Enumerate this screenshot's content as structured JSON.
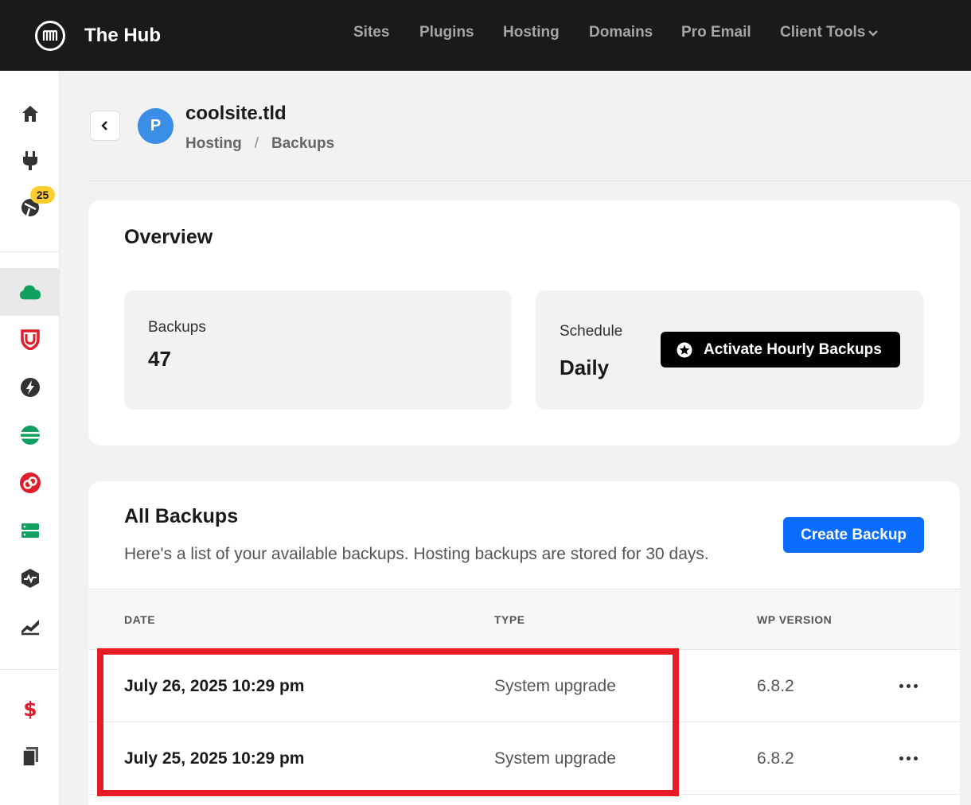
{
  "header": {
    "brand": "The Hub",
    "nav": [
      {
        "label": "Sites"
      },
      {
        "label": "Plugins"
      },
      {
        "label": "Hosting"
      },
      {
        "label": "Domains"
      },
      {
        "label": "Pro Email"
      },
      {
        "label": "Client Tools"
      }
    ]
  },
  "sidebar": {
    "badge_count": "25",
    "items": [
      {
        "icon": "home-icon"
      },
      {
        "icon": "plug-icon"
      },
      {
        "icon": "updates-icon"
      },
      {
        "icon": "cloud-icon"
      },
      {
        "icon": "shield-icon"
      },
      {
        "icon": "bolt-icon"
      },
      {
        "icon": "stripes-icon"
      },
      {
        "icon": "link-icon"
      },
      {
        "icon": "server-icon"
      },
      {
        "icon": "uptime-icon"
      },
      {
        "icon": "analytics-icon"
      },
      {
        "icon": "dollar-icon"
      },
      {
        "icon": "documents-icon"
      }
    ]
  },
  "site": {
    "avatar_letter": "P",
    "name": "coolsite.tld",
    "breadcrumb": [
      "Hosting",
      "/",
      "Backups"
    ]
  },
  "overview": {
    "title": "Overview",
    "backups_label": "Backups",
    "backups_count": "47",
    "schedule_label": "Schedule",
    "schedule_value": "Daily",
    "activate_button": "Activate Hourly Backups"
  },
  "all_backups": {
    "title": "All Backups",
    "description": "Here's a list of your available backups. Hosting backups are stored for 30 days.",
    "create_button": "Create Backup",
    "columns": [
      "DATE",
      "TYPE",
      "WP VERSION"
    ],
    "rows": [
      {
        "date": "July 26, 2025 10:29 pm",
        "type": "System upgrade",
        "wp_version": "6.8.2"
      },
      {
        "date": "July 25, 2025 10:29 pm",
        "type": "System upgrade",
        "wp_version": "6.8.2"
      }
    ]
  },
  "colors": {
    "topbar": "#1a1a1a",
    "primary_blue": "#0a6cff",
    "highlight_red": "#e81c24",
    "badge_yellow": "#fecf2f",
    "avatar_blue": "#3a8ee8"
  }
}
